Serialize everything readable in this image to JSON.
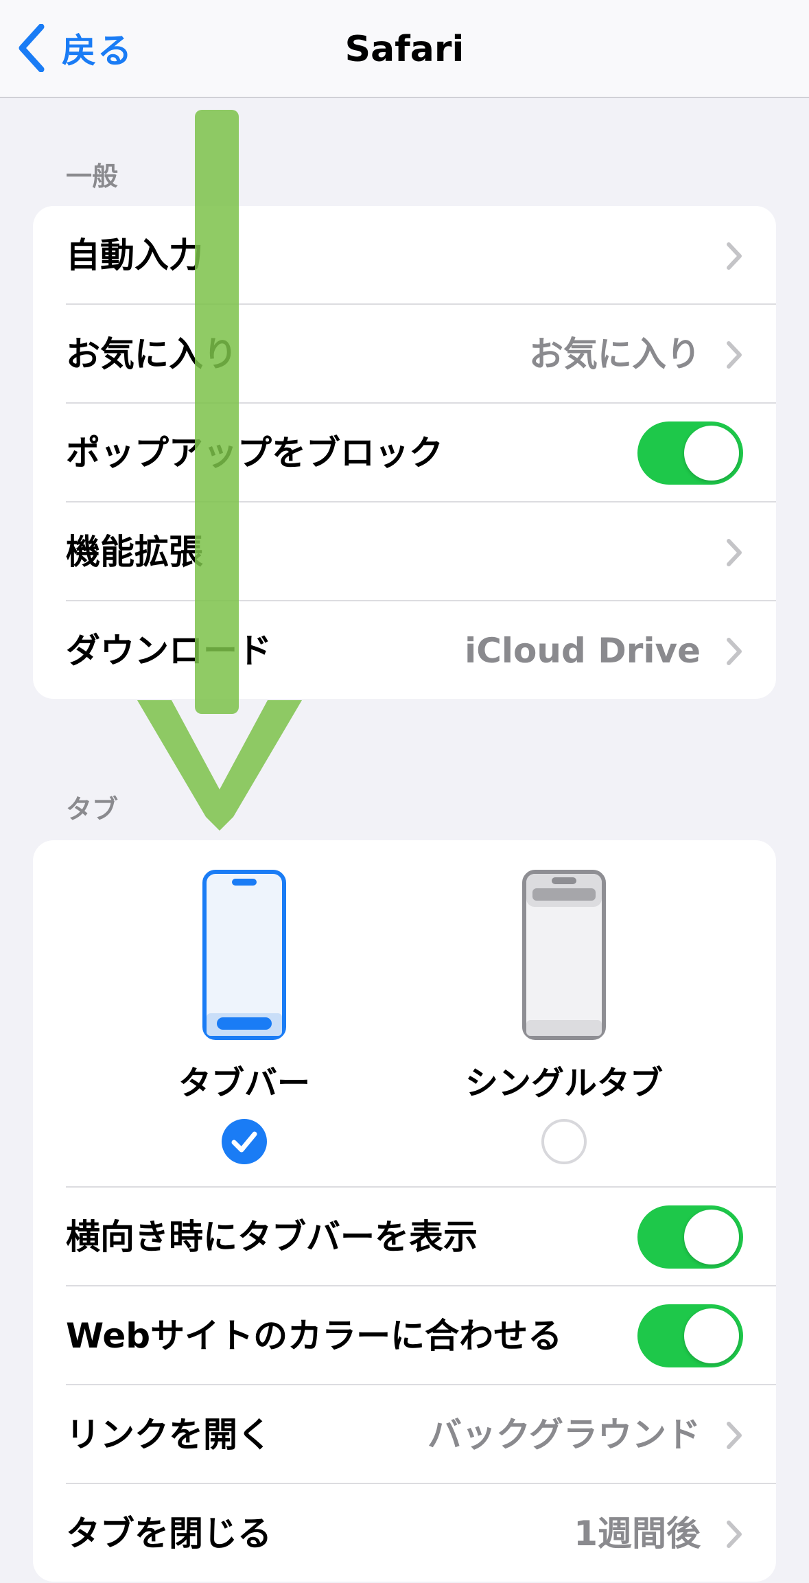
{
  "nav": {
    "back_label": "戻る",
    "title": "Safari"
  },
  "general": {
    "header": "一般",
    "rows": [
      {
        "label": "自動入力",
        "value": ""
      },
      {
        "label": "お気に入り",
        "value": "お気に入り"
      },
      {
        "label": "ポップアップをブロック",
        "toggle": true
      },
      {
        "label": "機能拡張",
        "value": ""
      },
      {
        "label": "ダウンロード",
        "value": "iCloud Drive"
      }
    ]
  },
  "tabs": {
    "header": "タブ",
    "options": [
      {
        "label": "タブバー",
        "selected": true
      },
      {
        "label": "シングルタブ",
        "selected": false
      }
    ],
    "rows": [
      {
        "label": "横向き時にタブバーを表示",
        "toggle": true
      },
      {
        "label": "Webサイトのカラーに合わせる",
        "toggle": true
      },
      {
        "label": "リンクを開く",
        "value": "バックグラウンド"
      },
      {
        "label": "タブを閉じる",
        "value": "1週間後"
      }
    ]
  },
  "colors": {
    "accent": "#1a7cf5",
    "toggle_on": "#1ec84a",
    "annotation_arrow": "#7cc24a"
  }
}
